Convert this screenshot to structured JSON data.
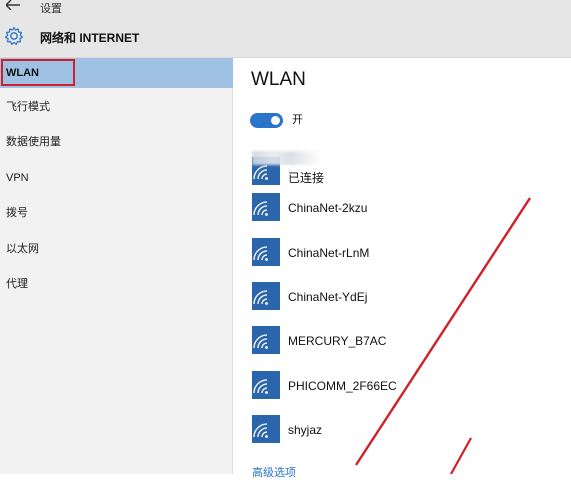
{
  "titlebar": {
    "title": "设置",
    "back_icon": "back-arrow-icon"
  },
  "header": {
    "section_title": "网络和 INTERNET",
    "icon": "gear-icon"
  },
  "sidebar": {
    "items": [
      {
        "label": "WLAN",
        "selected": true
      },
      {
        "label": "飞行模式"
      },
      {
        "label": "数据使用量"
      },
      {
        "label": "VPN"
      },
      {
        "label": "拨号"
      },
      {
        "label": "以太网"
      },
      {
        "label": "代理"
      }
    ]
  },
  "main": {
    "heading": "WLAN",
    "wifi_toggle": {
      "state_label": "开",
      "on": true
    },
    "connected_network": {
      "status": "已连接"
    },
    "networks": [
      {
        "name": "ChinaNet-2kzu"
      },
      {
        "name": "ChinaNet-rLnM"
      },
      {
        "name": "ChinaNet-YdEj"
      },
      {
        "name": "MERCURY_B7AC"
      },
      {
        "name": "PHICOMM_2F66EC"
      },
      {
        "name": "shyjaz"
      }
    ],
    "advanced_options": "高级选项"
  },
  "colors": {
    "accent": "#2a74c9",
    "wifi_tile": "#2b66ad",
    "selected_nav": "#9fc2e4",
    "highlight_box": "#d0202a",
    "annotation_arrow": "#d0202a"
  }
}
